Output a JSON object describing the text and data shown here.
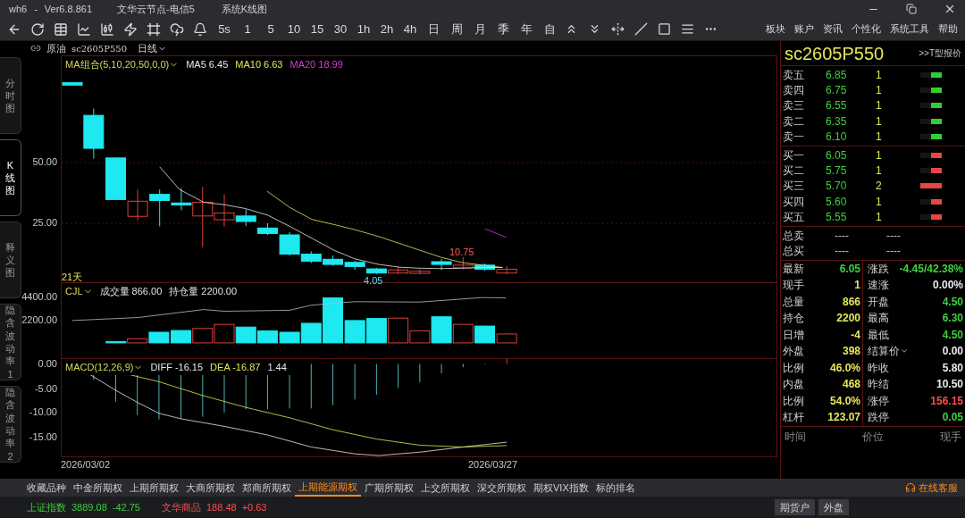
{
  "window": {
    "app": "wh6",
    "separator": "-",
    "version": "Ver6.8.861",
    "server": "文华云节点-电信5",
    "view": "系统K线图"
  },
  "toolbar": {
    "periods": [
      "5s",
      "1",
      "5",
      "10",
      "15",
      "30",
      "1h",
      "2h",
      "4h",
      "日",
      "周",
      "月",
      "季",
      "年",
      "自"
    ],
    "menus": [
      "板块",
      "账户",
      "资讯",
      "个性化",
      "系统工具",
      "帮助"
    ]
  },
  "chart_header": {
    "category": "原油",
    "symbol": "sc2605P550",
    "period": "日线"
  },
  "side_tabs": [
    {
      "label": "分时图",
      "selected": false
    },
    {
      "label": "K线图",
      "selected": true
    },
    {
      "label": "释义图",
      "selected": false
    },
    {
      "label": "隐含波动率1",
      "selected": false
    },
    {
      "label": "隐含波动率2",
      "selected": false
    }
  ],
  "main_chart": {
    "indicator": "MA组合(5,10,20,50,0,0)",
    "legend": [
      {
        "label": "MA5 6.45",
        "color": "#e8e8e8"
      },
      {
        "label": "MA10 6.63",
        "color": "#e6e65c"
      },
      {
        "label": "MA20 18.99",
        "color": "#d63ad6"
      }
    ],
    "yticks": [
      "50.00",
      "25.00"
    ],
    "high_label": "10.75",
    "low_label": "4.05",
    "days_label": "21天"
  },
  "volume_chart": {
    "indicator": "CJL",
    "legend": [
      "成交量 866.00",
      "持仓量 2200.00"
    ],
    "yticks": [
      "4400.00",
      "2200.00"
    ]
  },
  "macd_chart": {
    "indicator": "MACD(12,26,9)",
    "legend": [
      {
        "label": "DIFF -16.15",
        "color": "#e8e8e8"
      },
      {
        "label": "DEA -16.87",
        "color": "#e6e65c"
      },
      {
        "label": "1.44",
        "color": "#e8e8e8"
      }
    ],
    "yticks": [
      "0.00",
      "-5.00",
      "-10.00",
      "-15.00"
    ]
  },
  "dates": [
    "2026/03/02",
    "2026/03/27"
  ],
  "quote_panel": {
    "symbol": "sc2605P550",
    "link": ">>T型报价",
    "asks": [
      {
        "label": "卖五",
        "price": "6.85",
        "size": "1",
        "level": 0.5
      },
      {
        "label": "卖四",
        "price": "6.75",
        "size": "1",
        "level": 0.5
      },
      {
        "label": "卖三",
        "price": "6.55",
        "size": "1",
        "level": 0.5
      },
      {
        "label": "卖二",
        "price": "6.35",
        "size": "1",
        "level": 0.5
      },
      {
        "label": "卖一",
        "price": "6.10",
        "size": "1",
        "level": 0.5
      }
    ],
    "bids": [
      {
        "label": "买一",
        "price": "6.05",
        "size": "1",
        "level": 0.5
      },
      {
        "label": "买二",
        "price": "5.75",
        "size": "1",
        "level": 0.5
      },
      {
        "label": "买三",
        "price": "5.70",
        "size": "2",
        "level": 1
      },
      {
        "label": "买四",
        "price": "5.60",
        "size": "1",
        "level": 0.5
      },
      {
        "label": "买五",
        "price": "5.55",
        "size": "1",
        "level": 0.5
      }
    ],
    "totals": [
      {
        "label": "总卖",
        "values": [
          "----",
          "----"
        ]
      },
      {
        "label": "总买",
        "values": [
          "----",
          "----"
        ]
      }
    ],
    "stats": [
      {
        "left": {
          "label": "最新",
          "value": "6.05",
          "color": "#3ccf3c"
        },
        "right": {
          "label": "涨跌",
          "value": "-4.45/42.38%",
          "color": "#3ccf3c"
        }
      },
      {
        "left": {
          "label": "现手",
          "value": "1",
          "color": "#e6e65c"
        },
        "right": {
          "label": "速涨",
          "value": "0.00%",
          "color": "#e8e8e8"
        }
      },
      {
        "left": {
          "label": "总量",
          "value": "866",
          "color": "#e6e65c"
        },
        "right": {
          "label": "开盘",
          "value": "4.50",
          "color": "#3ccf3c"
        }
      },
      {
        "left": {
          "label": "持仓",
          "value": "2200",
          "color": "#e6e65c"
        },
        "right": {
          "label": "最高",
          "value": "6.30",
          "color": "#3ccf3c"
        }
      },
      {
        "left": {
          "label": "日增",
          "value": "-4",
          "color": "#e6e65c"
        },
        "right": {
          "label": "最低",
          "value": "4.50",
          "color": "#3ccf3c"
        }
      },
      {
        "left": {
          "label": "外盘",
          "value": "398",
          "color": "#e6e65c"
        },
        "right": {
          "label": "结算价",
          "value": "0.00",
          "color": "#e8e8e8",
          "dropdown": true
        }
      },
      {
        "left": {
          "label": "比例",
          "value": "46.0%",
          "color": "#e6e65c"
        },
        "right": {
          "label": "昨收",
          "value": "5.80",
          "color": "#e8e8e8"
        }
      },
      {
        "left": {
          "label": "内盘",
          "value": "468",
          "color": "#e6e65c"
        },
        "right": {
          "label": "昨结",
          "value": "10.50",
          "color": "#e8e8e8"
        }
      },
      {
        "left": {
          "label": "比例",
          "value": "54.0%",
          "color": "#e6e65c"
        },
        "right": {
          "label": "涨停",
          "value": "156.15",
          "color": "#ff4d4d"
        }
      },
      {
        "left": {
          "label": "杠杆",
          "value": "123.07",
          "color": "#e6e65c"
        },
        "right": {
          "label": "跌停",
          "value": "0.05",
          "color": "#3ccf3c"
        }
      }
    ],
    "trades_columns": [
      "时间",
      "价位",
      "现手"
    ]
  },
  "exchange_tabs": [
    {
      "label": "收藏品种",
      "selected": false
    },
    {
      "label": "中金所期权",
      "selected": false
    },
    {
      "label": "上期所期权",
      "selected": false
    },
    {
      "label": "大商所期权",
      "selected": false
    },
    {
      "label": "郑商所期权",
      "selected": false
    },
    {
      "label": "上期能源期权",
      "selected": true
    },
    {
      "label": "广期所期权",
      "selected": false
    },
    {
      "label": "上交所期权",
      "selected": false
    },
    {
      "label": "深交所期权",
      "selected": false
    },
    {
      "label": "期权VIX指数",
      "selected": false
    },
    {
      "label": "标的排名",
      "selected": false
    }
  ],
  "support_link": "在线客服",
  "status_bar": {
    "indices": [
      {
        "name": "上证指数",
        "value": "3889.08",
        "change": "-42.75",
        "color": "#3ccf3c"
      },
      {
        "name": "文华商品",
        "value": "188.48",
        "change": "+0.63",
        "color": "#ff4d4d"
      }
    ],
    "buttons": [
      "期货户",
      "外盘"
    ]
  }
}
